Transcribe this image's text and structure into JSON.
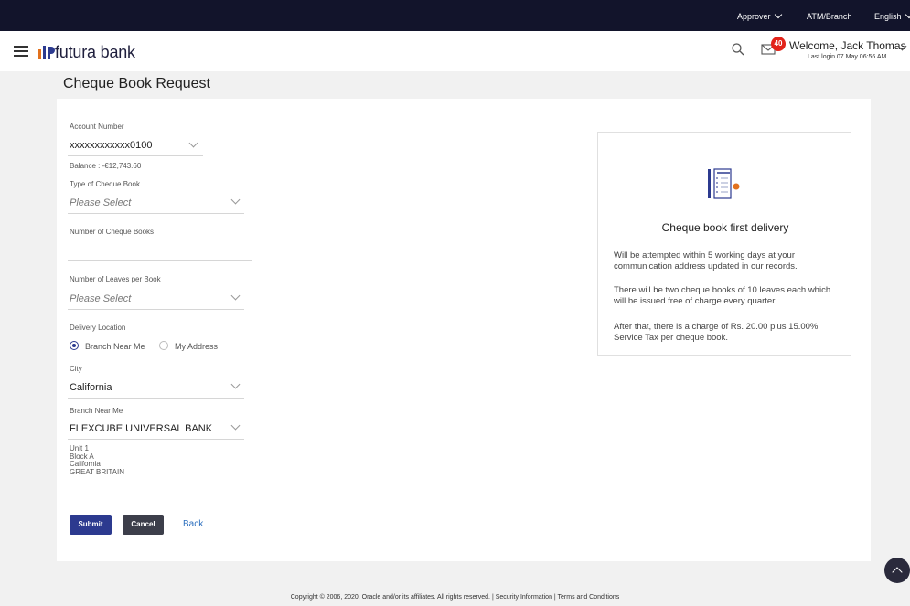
{
  "topbar": {
    "approver": "Approver",
    "atm_branch": "ATM/Branch",
    "language": "English"
  },
  "header": {
    "brand": "futura bank",
    "notification_count": "40",
    "welcome": "Welcome, Jack Thomas",
    "last_login": "Last login 07 May 06:56 AM"
  },
  "page": {
    "title": "Cheque Book Request"
  },
  "form": {
    "account_number_label": "Account Number",
    "account_number_value": "xxxxxxxxxxxx0100",
    "balance": "Balance : -€12,743.60",
    "type_label": "Type of Cheque Book",
    "type_placeholder": "Please Select",
    "num_books_label": "Number of Cheque Books",
    "num_books_value": "",
    "leaves_label": "Number of Leaves per Book",
    "leaves_placeholder": "Please Select",
    "delivery_label": "Delivery Location",
    "delivery_options": [
      "Branch Near Me",
      "My Address"
    ],
    "delivery_selected": "Branch Near Me",
    "city_label": "City",
    "city_value": "California",
    "branch_label": "Branch Near Me",
    "branch_value": "FLEXCUBE UNIVERSAL BANK",
    "address": [
      "Unit 1",
      "Block A",
      "California",
      "GREAT BRITAIN"
    ]
  },
  "actions": {
    "submit": "Submit",
    "cancel": "Cancel",
    "back": "Back"
  },
  "info": {
    "title": "Cheque book first delivery",
    "p1": "Will be attempted within 5 working days at your communication address updated in our records.",
    "p2": "There will be two cheque books of 10 leaves each which will be issued free of charge every quarter.",
    "p3": "After that, there is a charge of Rs. 20.00 plus 15.00% Service Tax per cheque book."
  },
  "footer": {
    "text": "Copyright © 2006, 2020, Oracle and/or its affiliates. All rights reserved. | Security Information | Terms and Conditions"
  },
  "colors": {
    "topbar": "#12142b",
    "primary": "#2c3a8f",
    "secondary": "#3c3e4a",
    "badge": "#e2231a",
    "link": "#2c6fbf"
  },
  "icons": [
    "menu-icon",
    "bank-logo-icon",
    "search-icon",
    "mail-icon",
    "chevron-down-icon",
    "cheque-book-icon",
    "scroll-top-icon"
  ]
}
